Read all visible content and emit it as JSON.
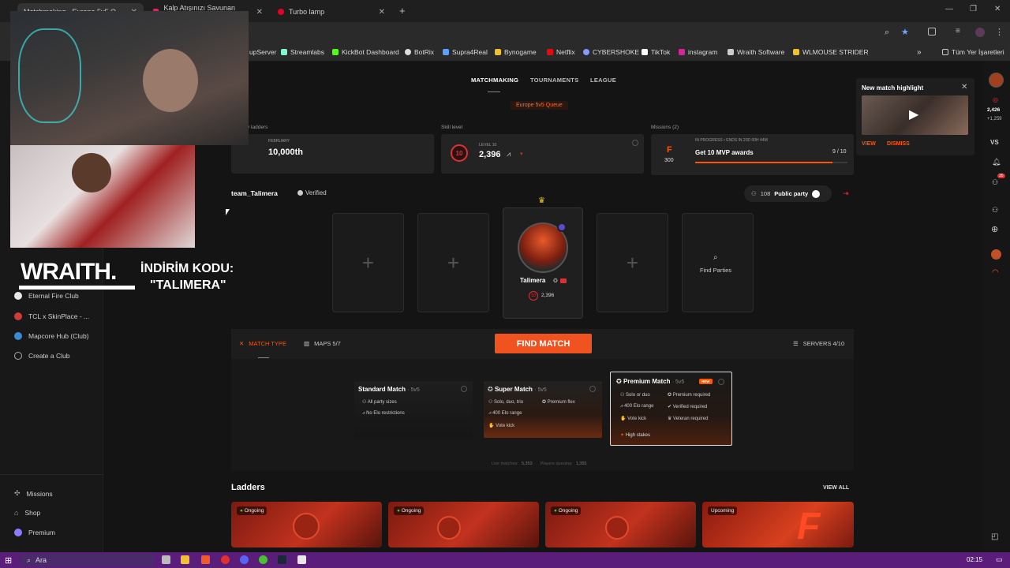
{
  "browser": {
    "tabs": [
      {
        "label": "Matchmaking - Europe 5v5 Q..."
      },
      {
        "label": "Kalp Atışınızı Savunan Gold..."
      },
      {
        "label": "Turbo lamp"
      }
    ],
    "bookmarks": [
      {
        "label": "upServer"
      },
      {
        "label": "Streamlabs"
      },
      {
        "label": "KickBot Dashboard"
      },
      {
        "label": "BotRix"
      },
      {
        "label": "Supra4Real"
      },
      {
        "label": "Bynogame"
      },
      {
        "label": "Netflix"
      },
      {
        "label": "CYBERSHOKE"
      },
      {
        "label": "TikTok"
      },
      {
        "label": "instagram"
      },
      {
        "label": "Wraith Software"
      },
      {
        "label": "WLMOUSE STRIDER"
      }
    ],
    "all_bookmarks": "Tüm Yer İşaretleri"
  },
  "overlay": {
    "brand": "WRAITH.",
    "promo_line1": "İNDİRİM KODU:",
    "promo_line2": "\"TALIMERA\""
  },
  "sidebar": {
    "clubs": [
      {
        "label": "Eternal Fire Club",
        "color": "#e8e8e8"
      },
      {
        "label": "TCL x SkinPlace - ...",
        "color": "#d03a3a"
      },
      {
        "label": "Mapcore Hub (Club)",
        "color": "#3a8ad0"
      }
    ],
    "create_club": "Create a Club",
    "bottom": [
      {
        "label": "Missions"
      },
      {
        "label": "Shop"
      },
      {
        "label": "Premium"
      }
    ]
  },
  "nav": {
    "items": [
      "MATCHMAKING",
      "TOURNAMENTS",
      "LEAGUE"
    ],
    "queue_badge": "Europe 5v5 Queue"
  },
  "stats": {
    "ladders_label": "y ladders",
    "ladders_month": "FEBRUARY",
    "ladders_rank": "10,000th",
    "skill_label": "Skill level",
    "level_caption": "LEVEL 10",
    "level_num": "10",
    "elo": "2,396",
    "missions_label": "Missions (2)",
    "mission_points": "300",
    "mission_status": "IN PROGRESS • ENDS IN 20D 00H 44M",
    "mission_title": "Get 10 MVP awards",
    "mission_progress_text": "9 / 10",
    "mission_progress": 0.9
  },
  "party": {
    "team_name": "team_Talimera",
    "verified": "Verified",
    "party_count": "108",
    "party_mode": "Public party",
    "player_name": "Talimera",
    "player_elo": "2,396",
    "player_level": "10",
    "find_parties": "Find Parties"
  },
  "matchbar": {
    "match_type": "MATCH TYPE",
    "maps": "MAPS 5/7",
    "find_match": "FIND MATCH",
    "servers": "SERVERS 4/10"
  },
  "modes": [
    {
      "title": "Standard Match",
      "suffix": "· 5v5",
      "features": [
        "All party sizes",
        "No Elo restrictions"
      ],
      "features2": []
    },
    {
      "title": "Super Match",
      "suffix": "· 5v5",
      "features": [
        "Solo, duo, trio",
        "400 Elo range",
        "Vote kick"
      ],
      "features2": [
        "Premium flex"
      ]
    },
    {
      "title": "Premium Match",
      "suffix": "· 5v5",
      "badge": "NEW",
      "features": [
        "Solo or duo",
        "400 Elo range",
        "Vote kick"
      ],
      "features2": [
        "Premium required",
        "Verified required",
        "Veteran required"
      ],
      "extra": "High stakes"
    }
  ],
  "queue_stats": {
    "live_label": "Live matches:",
    "live": "5,353",
    "players_label": "Players queuing:",
    "players": "1,355"
  },
  "ladders": {
    "title": "Ladders",
    "view_all": "VIEW ALL",
    "cards": [
      {
        "status": "Ongoing"
      },
      {
        "status": "Ongoing"
      },
      {
        "status": "Ongoing"
      },
      {
        "status": "Upcoming"
      }
    ]
  },
  "highlight": {
    "title": "New match highlight",
    "view": "VIEW",
    "dismiss": "DISMISS"
  },
  "rightbar": {
    "stat1": "2,426",
    "stat2": "+1,259",
    "vs": "VS",
    "badge": "35"
  },
  "taskbar": {
    "search": "Ara",
    "time": "02:15"
  },
  "colors": {
    "accent": "#ff5500",
    "find_match": "#f0531f",
    "taskbar": "#5a1e7a"
  }
}
